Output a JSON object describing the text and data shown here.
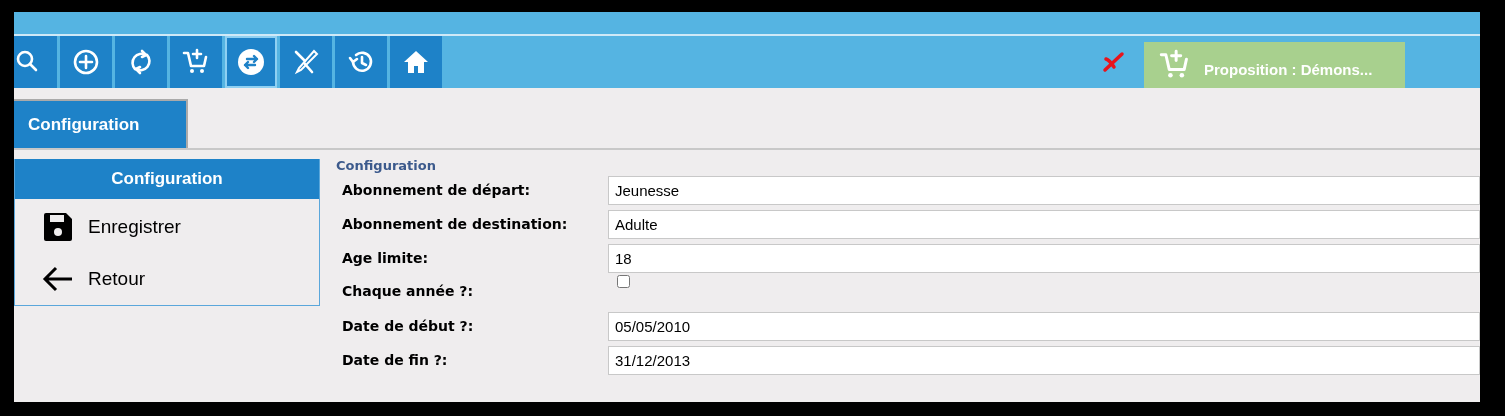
{
  "toolbar": {
    "buttons": [
      {
        "kind": "search",
        "selected": false
      },
      {
        "kind": "add",
        "selected": false
      },
      {
        "kind": "refresh",
        "selected": false
      },
      {
        "kind": "cart-add",
        "selected": false
      },
      {
        "kind": "swap",
        "selected": true
      },
      {
        "kind": "tools",
        "selected": false
      },
      {
        "kind": "history",
        "selected": false
      },
      {
        "kind": "home",
        "selected": false
      }
    ],
    "status_error": true,
    "proposition": "Proposition : Démons..."
  },
  "tabs": [
    {
      "label": "Configuration",
      "selected": true
    }
  ],
  "sidebar": {
    "title": "Configuration",
    "items": [
      {
        "kind": "save",
        "label": "Enregistrer"
      },
      {
        "kind": "back",
        "label": "Retour"
      }
    ]
  },
  "form": {
    "legend": "Configuration",
    "fields": [
      {
        "kind": "text",
        "label": "Abonnement de départ:",
        "value": "Jeunesse"
      },
      {
        "kind": "text",
        "label": "Abonnement de destination:",
        "value": "Adulte"
      },
      {
        "kind": "text",
        "label": "Age limite:",
        "value": "18"
      },
      {
        "kind": "checkbox",
        "label": "Chaque année ?:",
        "checked": false
      },
      {
        "kind": "text",
        "label": "Date de début ?:",
        "value": "05/05/2010"
      },
      {
        "kind": "text",
        "label": "Date de fin ?:",
        "value": "31/12/2013"
      }
    ]
  }
}
